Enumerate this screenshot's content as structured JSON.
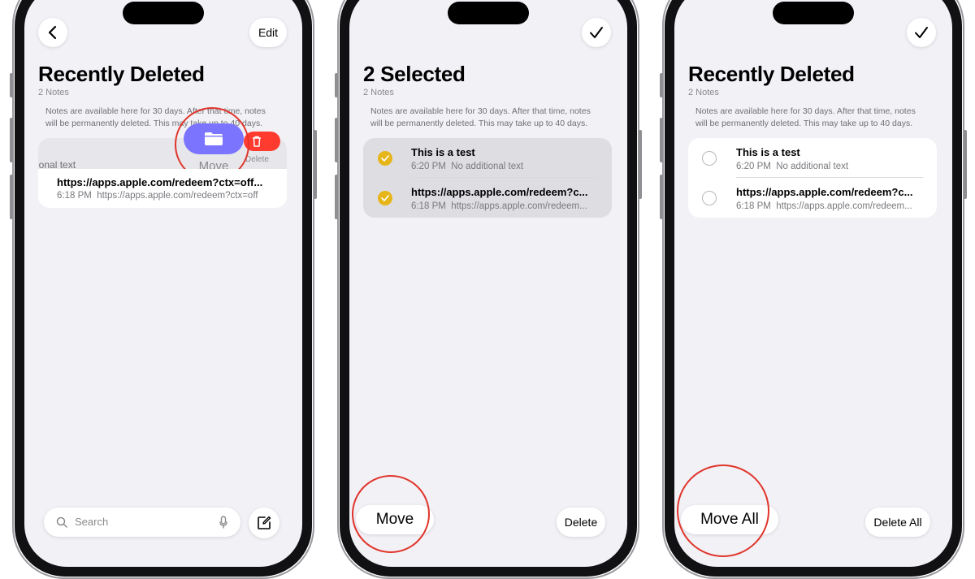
{
  "panel1": {
    "edit_label": "Edit",
    "title": "Recently Deleted",
    "subtitle": "2 Notes",
    "info": "Notes are available here for 30 days. After that time, notes will be permanently deleted. This may take up to 40 days.",
    "swiped_row_text": "ional text",
    "move_action": "Move",
    "delete_action": "Delete",
    "note2": {
      "title": "https://apps.apple.com/redeem?ctx=off...",
      "time": "6:18 PM",
      "preview": "https://apps.apple.com/redeem?ctx=off"
    },
    "search_placeholder": "Search"
  },
  "panel2": {
    "title": "2 Selected",
    "subtitle": "2 Notes",
    "info": "Notes are available here for 30 days. After that time, notes will be permanently deleted. This may take up to 40 days.",
    "notes": [
      {
        "title": "This is a test",
        "time": "6:20 PM",
        "preview": "No additional text"
      },
      {
        "title": "https://apps.apple.com/redeem?c...",
        "time": "6:18 PM",
        "preview": "https://apps.apple.com/redeem..."
      }
    ],
    "move_label": "Move",
    "delete_label": "Delete"
  },
  "panel3": {
    "title": "Recently Deleted",
    "subtitle": "2 Notes",
    "info": "Notes are available here for 30 days. After that time, notes will be permanently deleted. This may take up to 40 days.",
    "notes": [
      {
        "title": "This is a test",
        "time": "6:20 PM",
        "preview": "No additional text"
      },
      {
        "title": "https://apps.apple.com/redeem?c...",
        "time": "6:18 PM",
        "preview": "https://apps.apple.com/redeem..."
      }
    ],
    "move_all_label": "Move All",
    "delete_all_label": "Delete All"
  },
  "colors": {
    "accent_yellow": "#e6b619",
    "move_purple": "#7b74ff",
    "delete_red": "#ff3b30",
    "highlight_ring": "#e0352b",
    "background": "#f2f1f6"
  },
  "icons": [
    "back-chevron-icon",
    "checkmark-icon",
    "folder-icon",
    "trash-icon",
    "search-icon",
    "microphone-icon",
    "compose-icon"
  ]
}
